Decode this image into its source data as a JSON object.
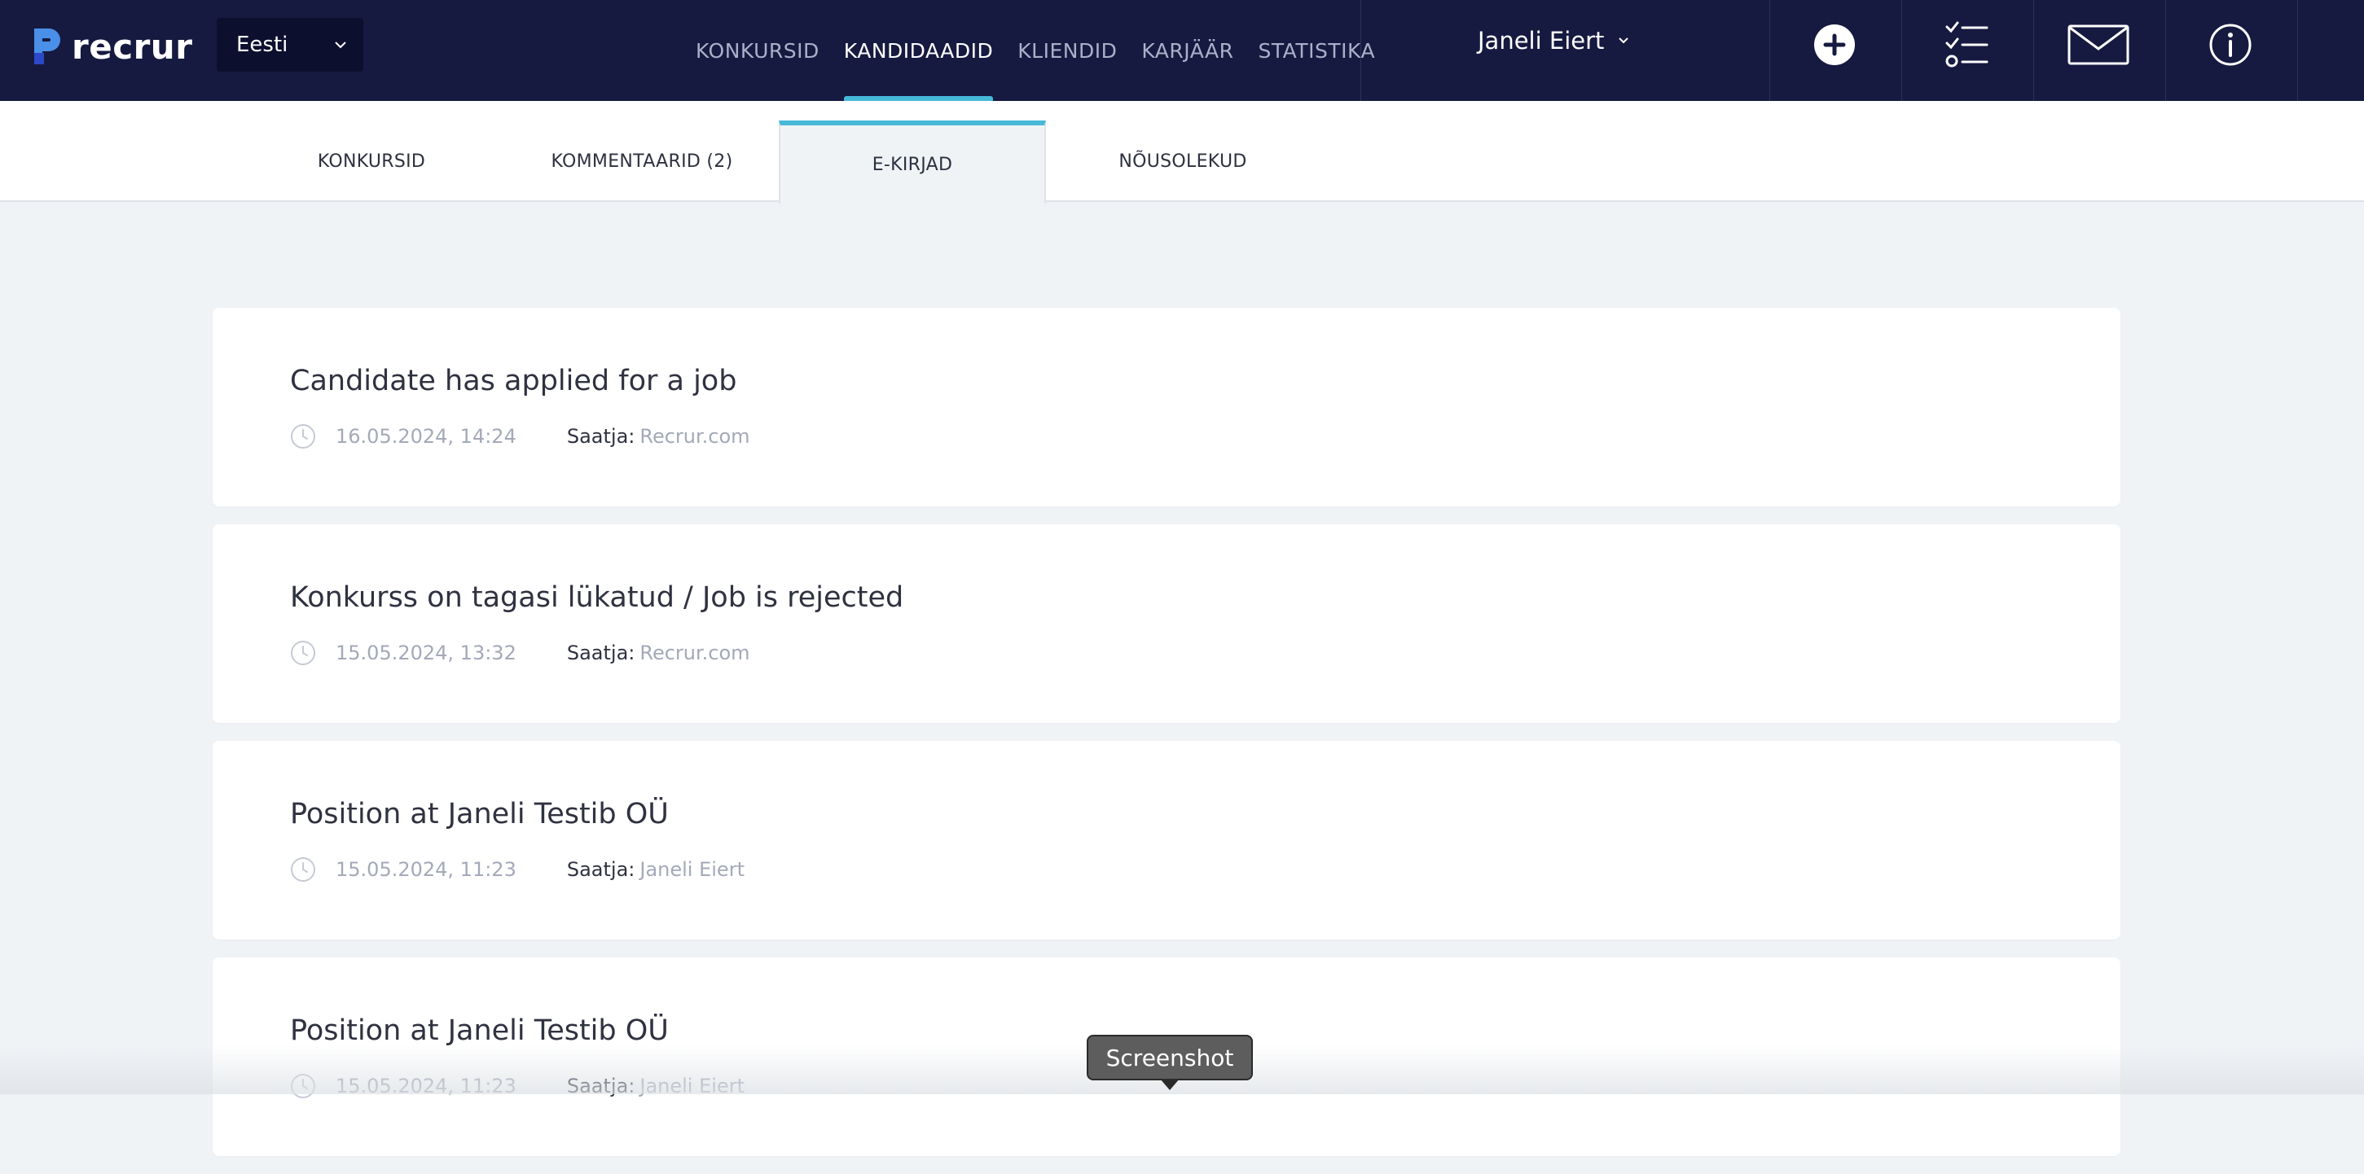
{
  "brand": {
    "name": "recrur",
    "accent": "#47b8d8",
    "nav_bg": "#161a40"
  },
  "language": {
    "selected": "Eesti"
  },
  "nav": {
    "items": [
      {
        "label": "KONKURSID",
        "active": false
      },
      {
        "label": "KANDIDAADID",
        "active": true
      },
      {
        "label": "KLIENDID",
        "active": false
      },
      {
        "label": "KARJÄÄR",
        "active": false
      },
      {
        "label": "STATISTIKA",
        "active": false
      }
    ]
  },
  "user": {
    "name": "Janeli Eiert"
  },
  "toolbar_icons": [
    "plus-circle-icon",
    "checklist-icon",
    "mail-icon",
    "info-icon"
  ],
  "subtabs": [
    {
      "label": "KONKURSID",
      "active": false
    },
    {
      "label": "KOMMENTAARID (2)",
      "active": false
    },
    {
      "label": "E-KIRJAD",
      "active": true
    },
    {
      "label": "NÕUSOLEKUD",
      "active": false
    }
  ],
  "emails": [
    {
      "subject": "Candidate has applied for a job",
      "date": "16.05.2024, 14:24",
      "sender_label": "Saatja:",
      "sender": "Recrur.com"
    },
    {
      "subject": "Konkurss on tagasi lükatud / Job is rejected",
      "date": "15.05.2024, 13:32",
      "sender_label": "Saatja:",
      "sender": "Recrur.com"
    },
    {
      "subject": "Position at Janeli Testib OÜ",
      "date": "15.05.2024, 11:23",
      "sender_label": "Saatja:",
      "sender": "Janeli Eiert"
    },
    {
      "subject": "Position at Janeli Testib OÜ",
      "date": "15.05.2024, 11:23",
      "sender_label": "Saatja:",
      "sender": "Janeli Eiert"
    }
  ],
  "tooltip": {
    "text": "Screenshot"
  }
}
